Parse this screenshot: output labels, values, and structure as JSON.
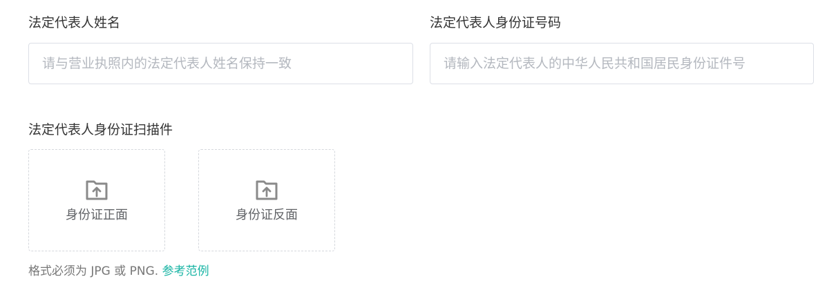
{
  "legal_rep_name": {
    "label": "法定代表人姓名",
    "placeholder": "请与营业执照内的法定代表人姓名保持一致",
    "value": ""
  },
  "legal_rep_id_number": {
    "label": "法定代表人身份证号码",
    "placeholder": "请输入法定代表人的中华人民共和国居民身份证件号",
    "value": ""
  },
  "id_scan": {
    "label": "法定代表人身份证扫描件",
    "front_label": "身份证正面",
    "back_label": "身份证反面",
    "upload_icon": "folder-upload-icon",
    "hint_text": "格式必须为 JPG 或 PNG. ",
    "example_link": "参考范例"
  },
  "colors": {
    "accent_link": "#18b4a4",
    "border": "#dcdfe6",
    "placeholder": "#b4b8bf",
    "icon": "#8a8a8a"
  }
}
